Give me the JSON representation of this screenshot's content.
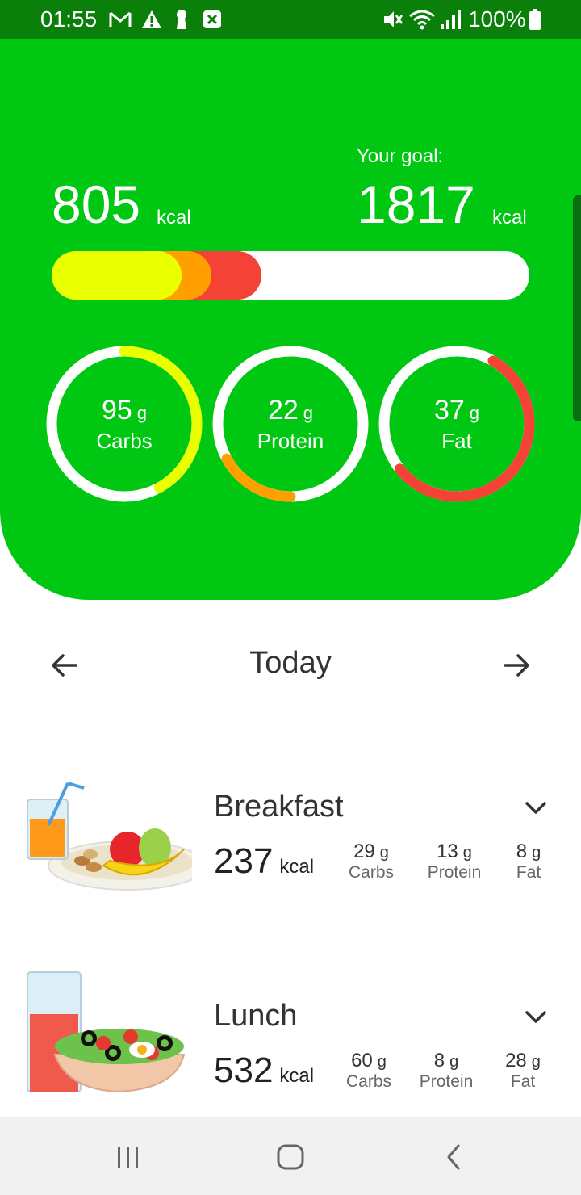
{
  "status_bar": {
    "time": "01:55",
    "battery": "100%"
  },
  "summary": {
    "consumed_value": "805",
    "consumed_unit": "kcal",
    "goal_label": "Your goal:",
    "goal_value": "1817",
    "goal_unit": "kcal",
    "progress_fraction": 0.44,
    "colors": {
      "carbs": "#eaff00",
      "protein": "#ffa000",
      "fat": "#f44336",
      "background": "#00c812"
    }
  },
  "rings": [
    {
      "value": "95",
      "unit": "g",
      "label": "Carbs",
      "fraction": 0.42
    },
    {
      "value": "22",
      "unit": "g",
      "label": "Protein",
      "fraction": 0.17
    },
    {
      "value": "37",
      "unit": "g",
      "label": "Fat",
      "fraction": 0.56
    }
  ],
  "date_nav": {
    "prev_icon": "arrow-left-icon",
    "label": "Today",
    "next_icon": "arrow-right-icon"
  },
  "meals": [
    {
      "title": "Breakfast",
      "kcal": "237",
      "kcal_unit": "kcal",
      "macros": [
        {
          "value": "29",
          "unit": "g",
          "label": "Carbs"
        },
        {
          "value": "13",
          "unit": "g",
          "label": "Protein"
        },
        {
          "value": "8",
          "unit": "g",
          "label": "Fat"
        }
      ]
    },
    {
      "title": "Lunch",
      "kcal": "532",
      "kcal_unit": "kcal",
      "macros": [
        {
          "value": "60",
          "unit": "g",
          "label": "Carbs"
        },
        {
          "value": "8",
          "unit": "g",
          "label": "Protein"
        },
        {
          "value": "28",
          "unit": "g",
          "label": "Fat"
        }
      ]
    }
  ]
}
